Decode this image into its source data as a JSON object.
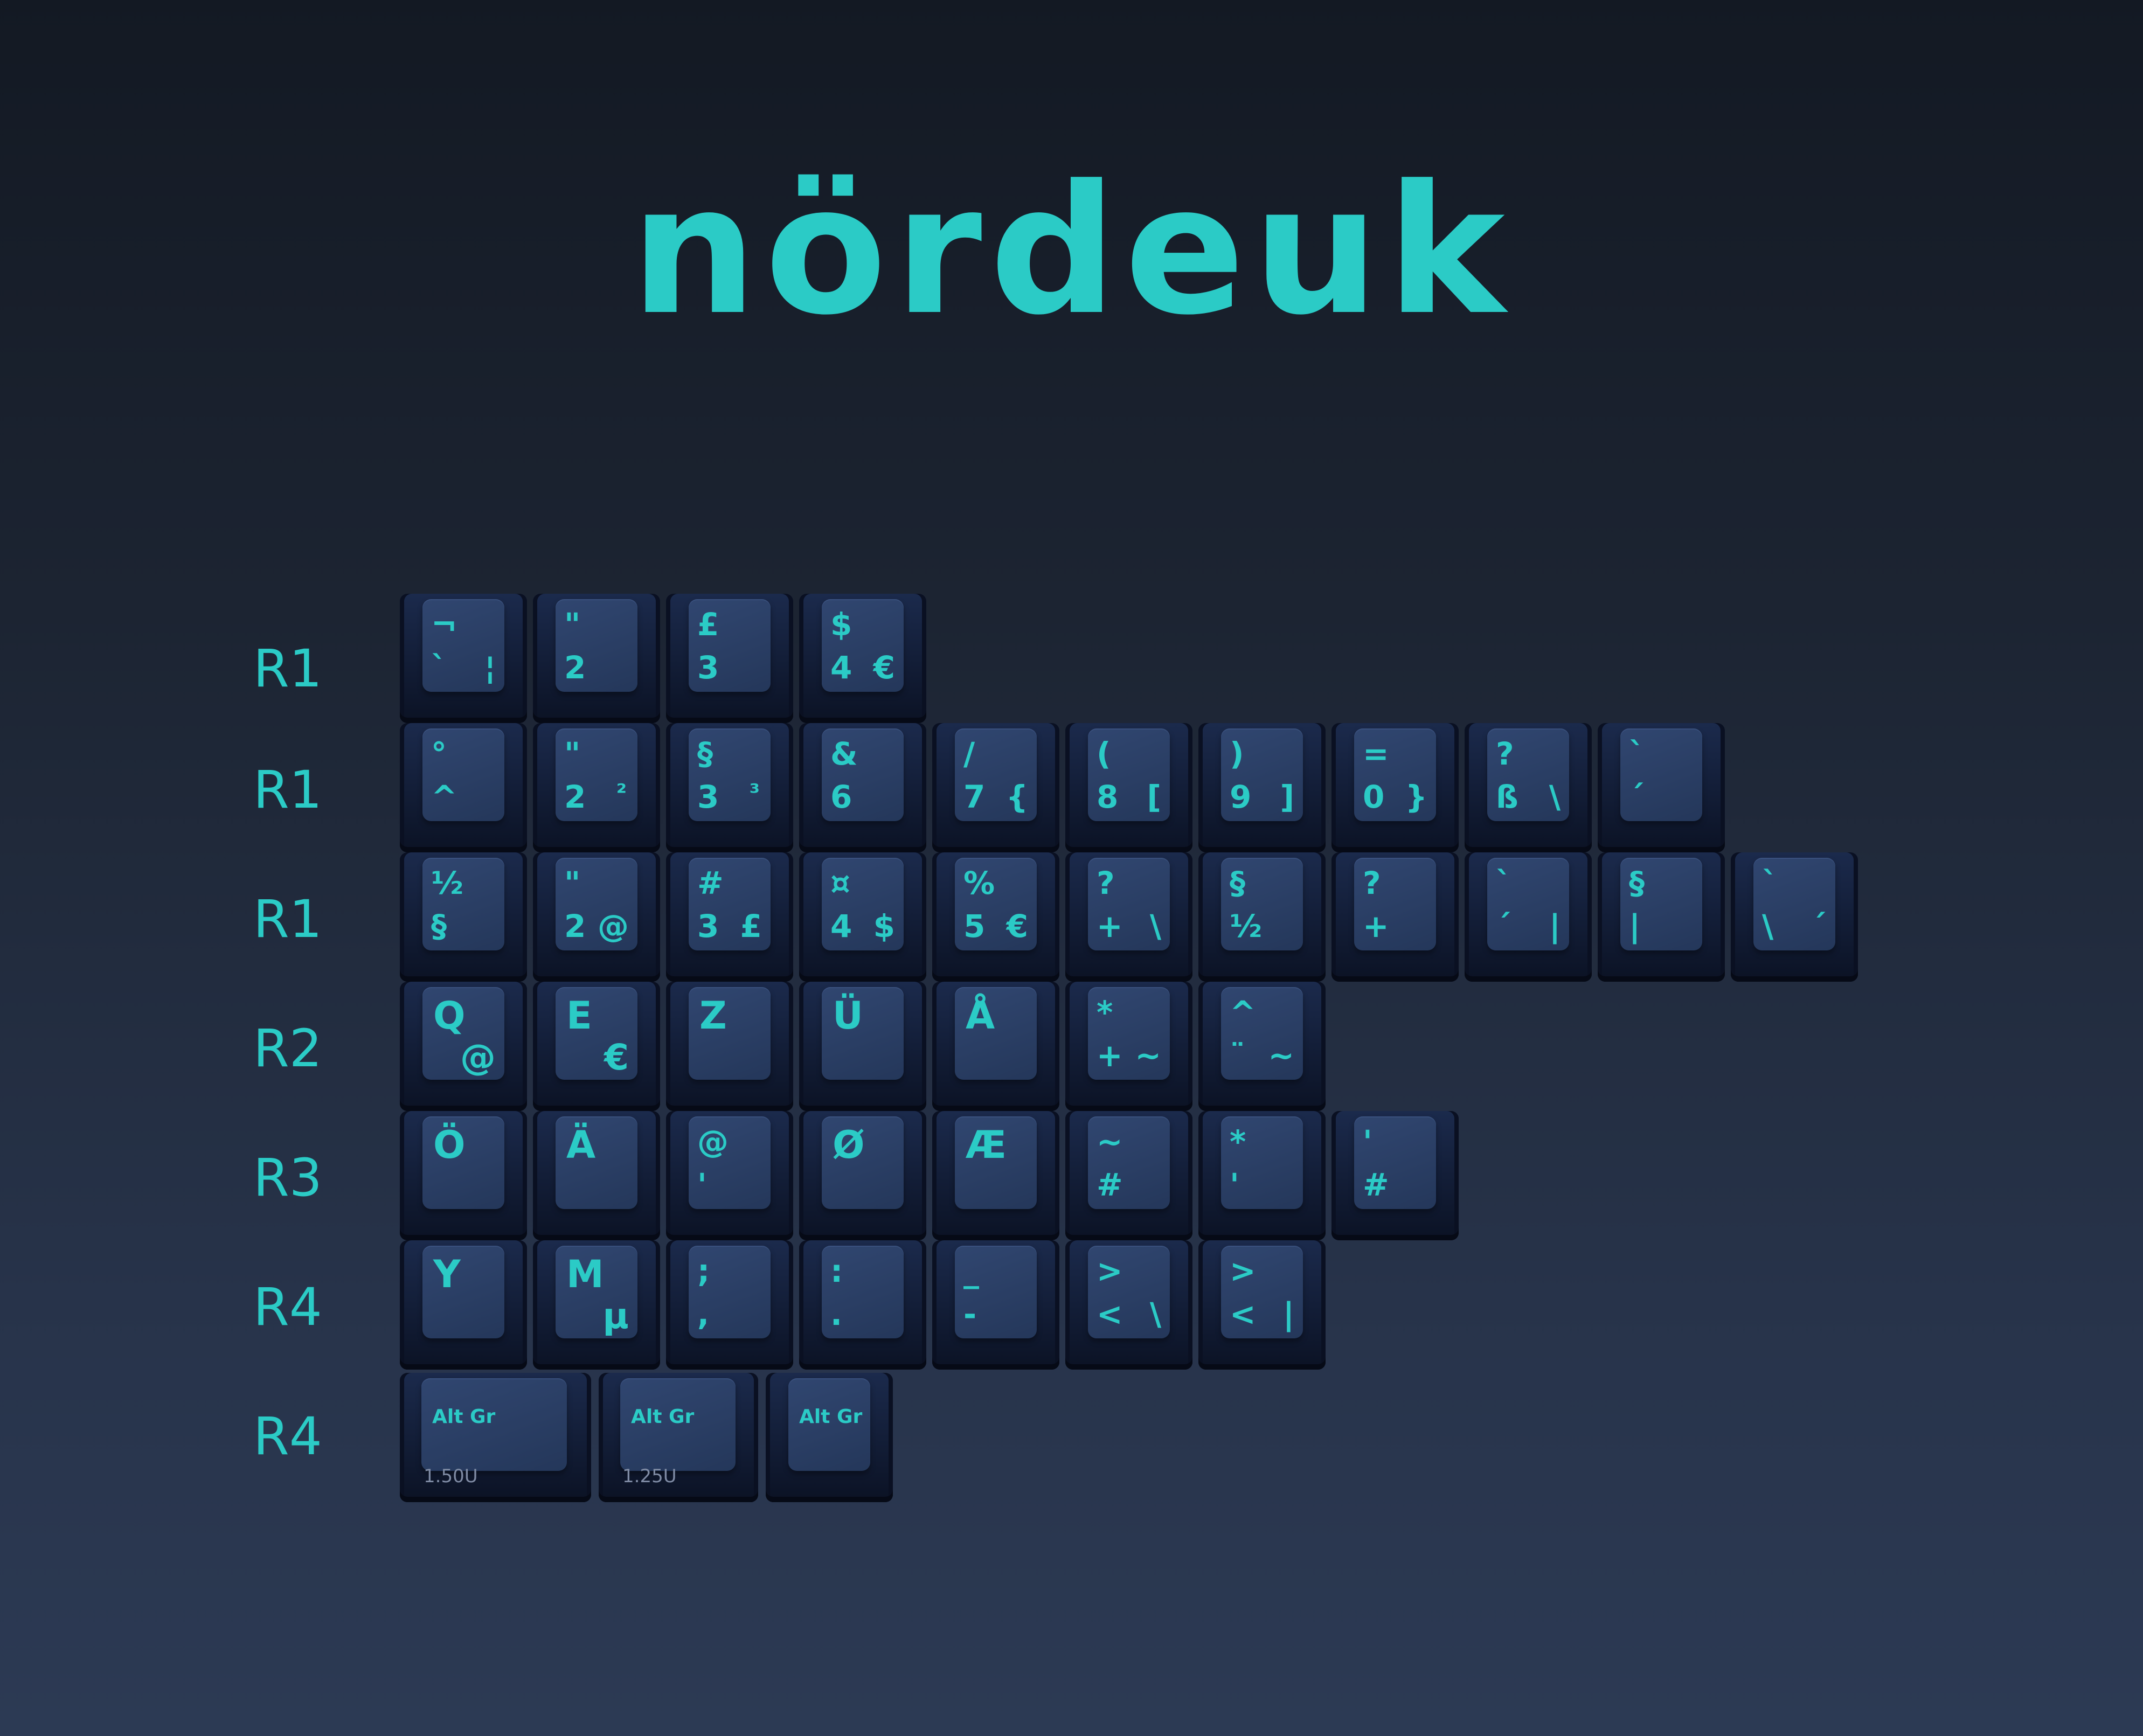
{
  "title": "nördeuk",
  "accent_color": "#2bcbc6",
  "row_labels": [
    "R1",
    "R1",
    "R1",
    "R2",
    "R3",
    "R4",
    "R4"
  ],
  "rows": [
    [
      {
        "tl": "¬",
        "bl": "`",
        "br": "¦"
      },
      {
        "tl": "\"",
        "bl": "2"
      },
      {
        "tl": "£",
        "bl": "3"
      },
      {
        "tl": "$",
        "bl": "4",
        "br": "€"
      }
    ],
    [
      {
        "tl": "°",
        "bl": "^"
      },
      {
        "tl": "\"",
        "bl": "2",
        "br": "²"
      },
      {
        "tl": "§",
        "bl": "3",
        "br": "³"
      },
      {
        "tl": "&",
        "bl": "6"
      },
      {
        "tl": "/",
        "bl": "7",
        "br": "{"
      },
      {
        "tl": "(",
        "bl": "8",
        "br": "["
      },
      {
        "tl": ")",
        "bl": "9",
        "br": "]"
      },
      {
        "tl": "=",
        "bl": "0",
        "br": "}"
      },
      {
        "tl": "?",
        "bl": "ß",
        "br": "\\"
      },
      {
        "tl": "`",
        "bl": "´"
      }
    ],
    [
      {
        "tl": "½",
        "bl": "§"
      },
      {
        "tl": "\"",
        "bl": "2",
        "br": "@"
      },
      {
        "tl": "#",
        "bl": "3",
        "br": "£"
      },
      {
        "tl": "¤",
        "bl": "4",
        "br": "$"
      },
      {
        "tl": "%",
        "bl": "5",
        "br": "€"
      },
      {
        "tl": "?",
        "bl": "+",
        "br": "\\"
      },
      {
        "tl": "§",
        "bl": "½"
      },
      {
        "tl": "?",
        "bl": "+"
      },
      {
        "tl": "`",
        "bl": "´",
        "br": "|"
      },
      {
        "tl": "§",
        "bl": "|"
      },
      {
        "tl": "`",
        "bl": "\\",
        "br": "´"
      }
    ],
    [
      {
        "big": "Q",
        "bigbr": "@"
      },
      {
        "big": "E",
        "bigbr": "€"
      },
      {
        "big": "Z"
      },
      {
        "big": "Ü"
      },
      {
        "big": "Å"
      },
      {
        "tl": "*",
        "bl": "+",
        "br": "~"
      },
      {
        "tl": "^",
        "bl": "¨",
        "br": "~"
      }
    ],
    [
      {
        "big": "Ö"
      },
      {
        "big": "Ä"
      },
      {
        "tl": "@",
        "bl": "'"
      },
      {
        "big": "Ø"
      },
      {
        "big": "Æ"
      },
      {
        "tl": "~",
        "bl": "#"
      },
      {
        "tl": "*",
        "bl": "'"
      },
      {
        "tl": "'",
        "bl": "#"
      }
    ],
    [
      {
        "big": "Y"
      },
      {
        "big": "M",
        "bigbr": "µ"
      },
      {
        "tl": ";",
        "bl": ","
      },
      {
        "tl": ":",
        "bl": "."
      },
      {
        "tl": "_",
        "bl": "-"
      },
      {
        "tl": ">",
        "bl": "<",
        "br": "\\"
      },
      {
        "tl": ">",
        "bl": "<",
        "br": "|"
      }
    ],
    [
      {
        "altgr": "Alt Gr",
        "unit": "1.50U"
      },
      {
        "altgr": "Alt Gr",
        "unit": "1.25U"
      },
      {
        "altgr": "Alt Gr"
      }
    ]
  ]
}
